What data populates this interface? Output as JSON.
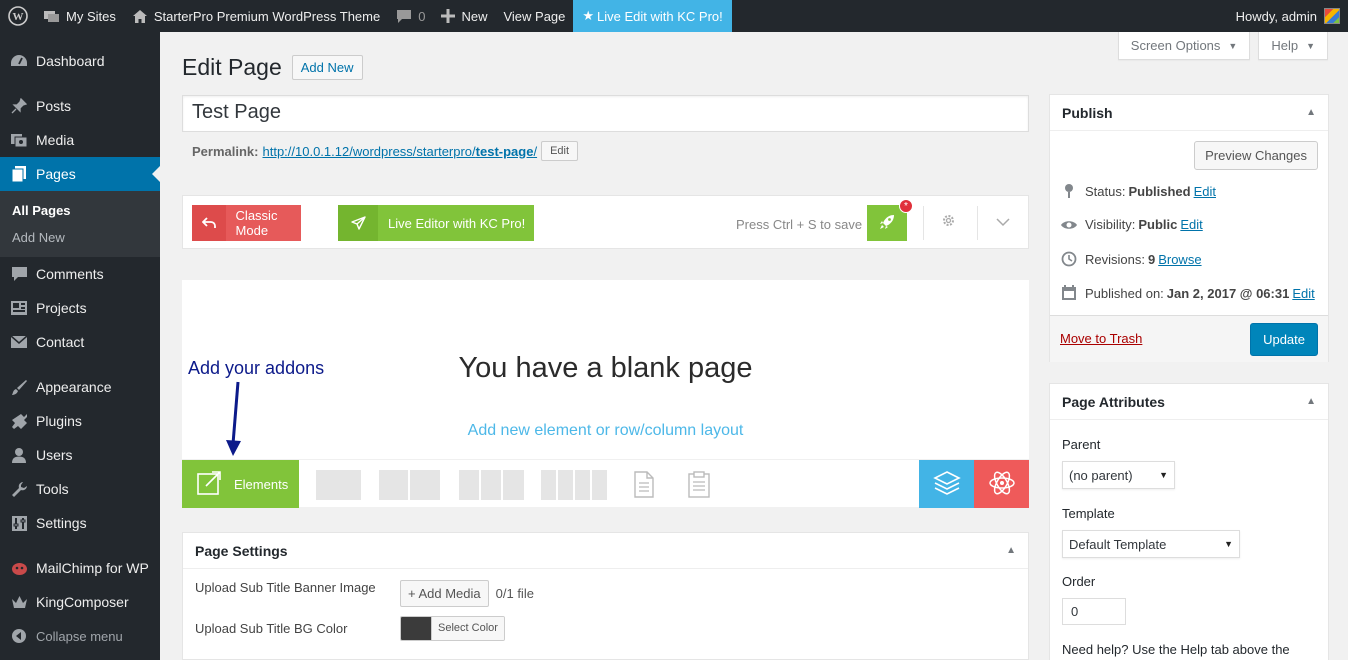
{
  "adminbar": {
    "my_sites": "My Sites",
    "site_name": "StarterPro Premium WordPress Theme",
    "comments_count": "0",
    "new": "New",
    "view_page": "View Page",
    "live_edit": "Live Edit with KC Pro!",
    "howdy": "Howdy, admin"
  },
  "sidebar": {
    "items": [
      {
        "label": "Dashboard",
        "icon": "dashboard-icon"
      },
      {
        "label": "Posts",
        "icon": "pin-icon"
      },
      {
        "label": "Media",
        "icon": "media-icon"
      },
      {
        "label": "Pages",
        "icon": "pages-icon"
      },
      {
        "label": "Comments",
        "icon": "comment-icon"
      },
      {
        "label": "Projects",
        "icon": "portfolio-icon"
      },
      {
        "label": "Contact",
        "icon": "mail-icon"
      },
      {
        "label": "Appearance",
        "icon": "brush-icon"
      },
      {
        "label": "Plugins",
        "icon": "plugin-icon"
      },
      {
        "label": "Users",
        "icon": "user-icon"
      },
      {
        "label": "Tools",
        "icon": "wrench-icon"
      },
      {
        "label": "Settings",
        "icon": "settings-icon"
      },
      {
        "label": "MailChimp for WP",
        "icon": "mailchimp-icon"
      },
      {
        "label": "KingComposer",
        "icon": "crown-icon"
      },
      {
        "label": "Collapse menu",
        "icon": "collapse-icon"
      }
    ],
    "submenu": [
      "All Pages",
      "Add New"
    ]
  },
  "screen_options": "Screen Options",
  "help": "Help",
  "heading": "Edit Page",
  "add_new": "Add New",
  "title_value": "Test Page",
  "permalink": {
    "label": "Permalink:",
    "url_base": "http://10.0.1.12/wordpress/starterpro/",
    "slug": "test-page",
    "trail": "/",
    "edit": "Edit"
  },
  "kc": {
    "classic_mode": "Classic Mode",
    "live_editor": "Live Editor with KC Pro!",
    "save_hint": "Press Ctrl + S to save",
    "badge": "*",
    "addons_hint": "Add your addons",
    "blank_title": "You have a blank page",
    "blank_link": "Add new element or row/column layout",
    "elements": "Elements"
  },
  "page_settings": {
    "title": "Page Settings",
    "banner_label": "Upload Sub Title Banner Image",
    "add_media": "+ Add Media",
    "file_count": "0/1 file",
    "bg_label": "Upload Sub Title BG Color",
    "select_color": "Select Color",
    "bg_color": "#3b3b3b"
  },
  "publish": {
    "title": "Publish",
    "preview": "Preview Changes",
    "status_label": "Status:",
    "status_value": "Published",
    "visibility_label": "Visibility:",
    "visibility_value": "Public",
    "revisions_label": "Revisions:",
    "revisions_value": "9",
    "browse": "Browse",
    "published_label": "Published on:",
    "published_value": "Jan 2, 2017 @ 06:31",
    "edit": "Edit",
    "trash": "Move to Trash",
    "update": "Update"
  },
  "attributes": {
    "title": "Page Attributes",
    "parent_label": "Parent",
    "parent_value": "(no parent)",
    "template_label": "Template",
    "template_value": "Default Template",
    "order_label": "Order",
    "order_value": "0",
    "help": "Need help? Use the Help tab above the"
  },
  "colors": {
    "accent": "#0073aa",
    "admin_bg": "#23282d",
    "kc_green": "#81c43a",
    "kc_red": "#e65a5a",
    "kc_blue": "#42b4e6"
  }
}
